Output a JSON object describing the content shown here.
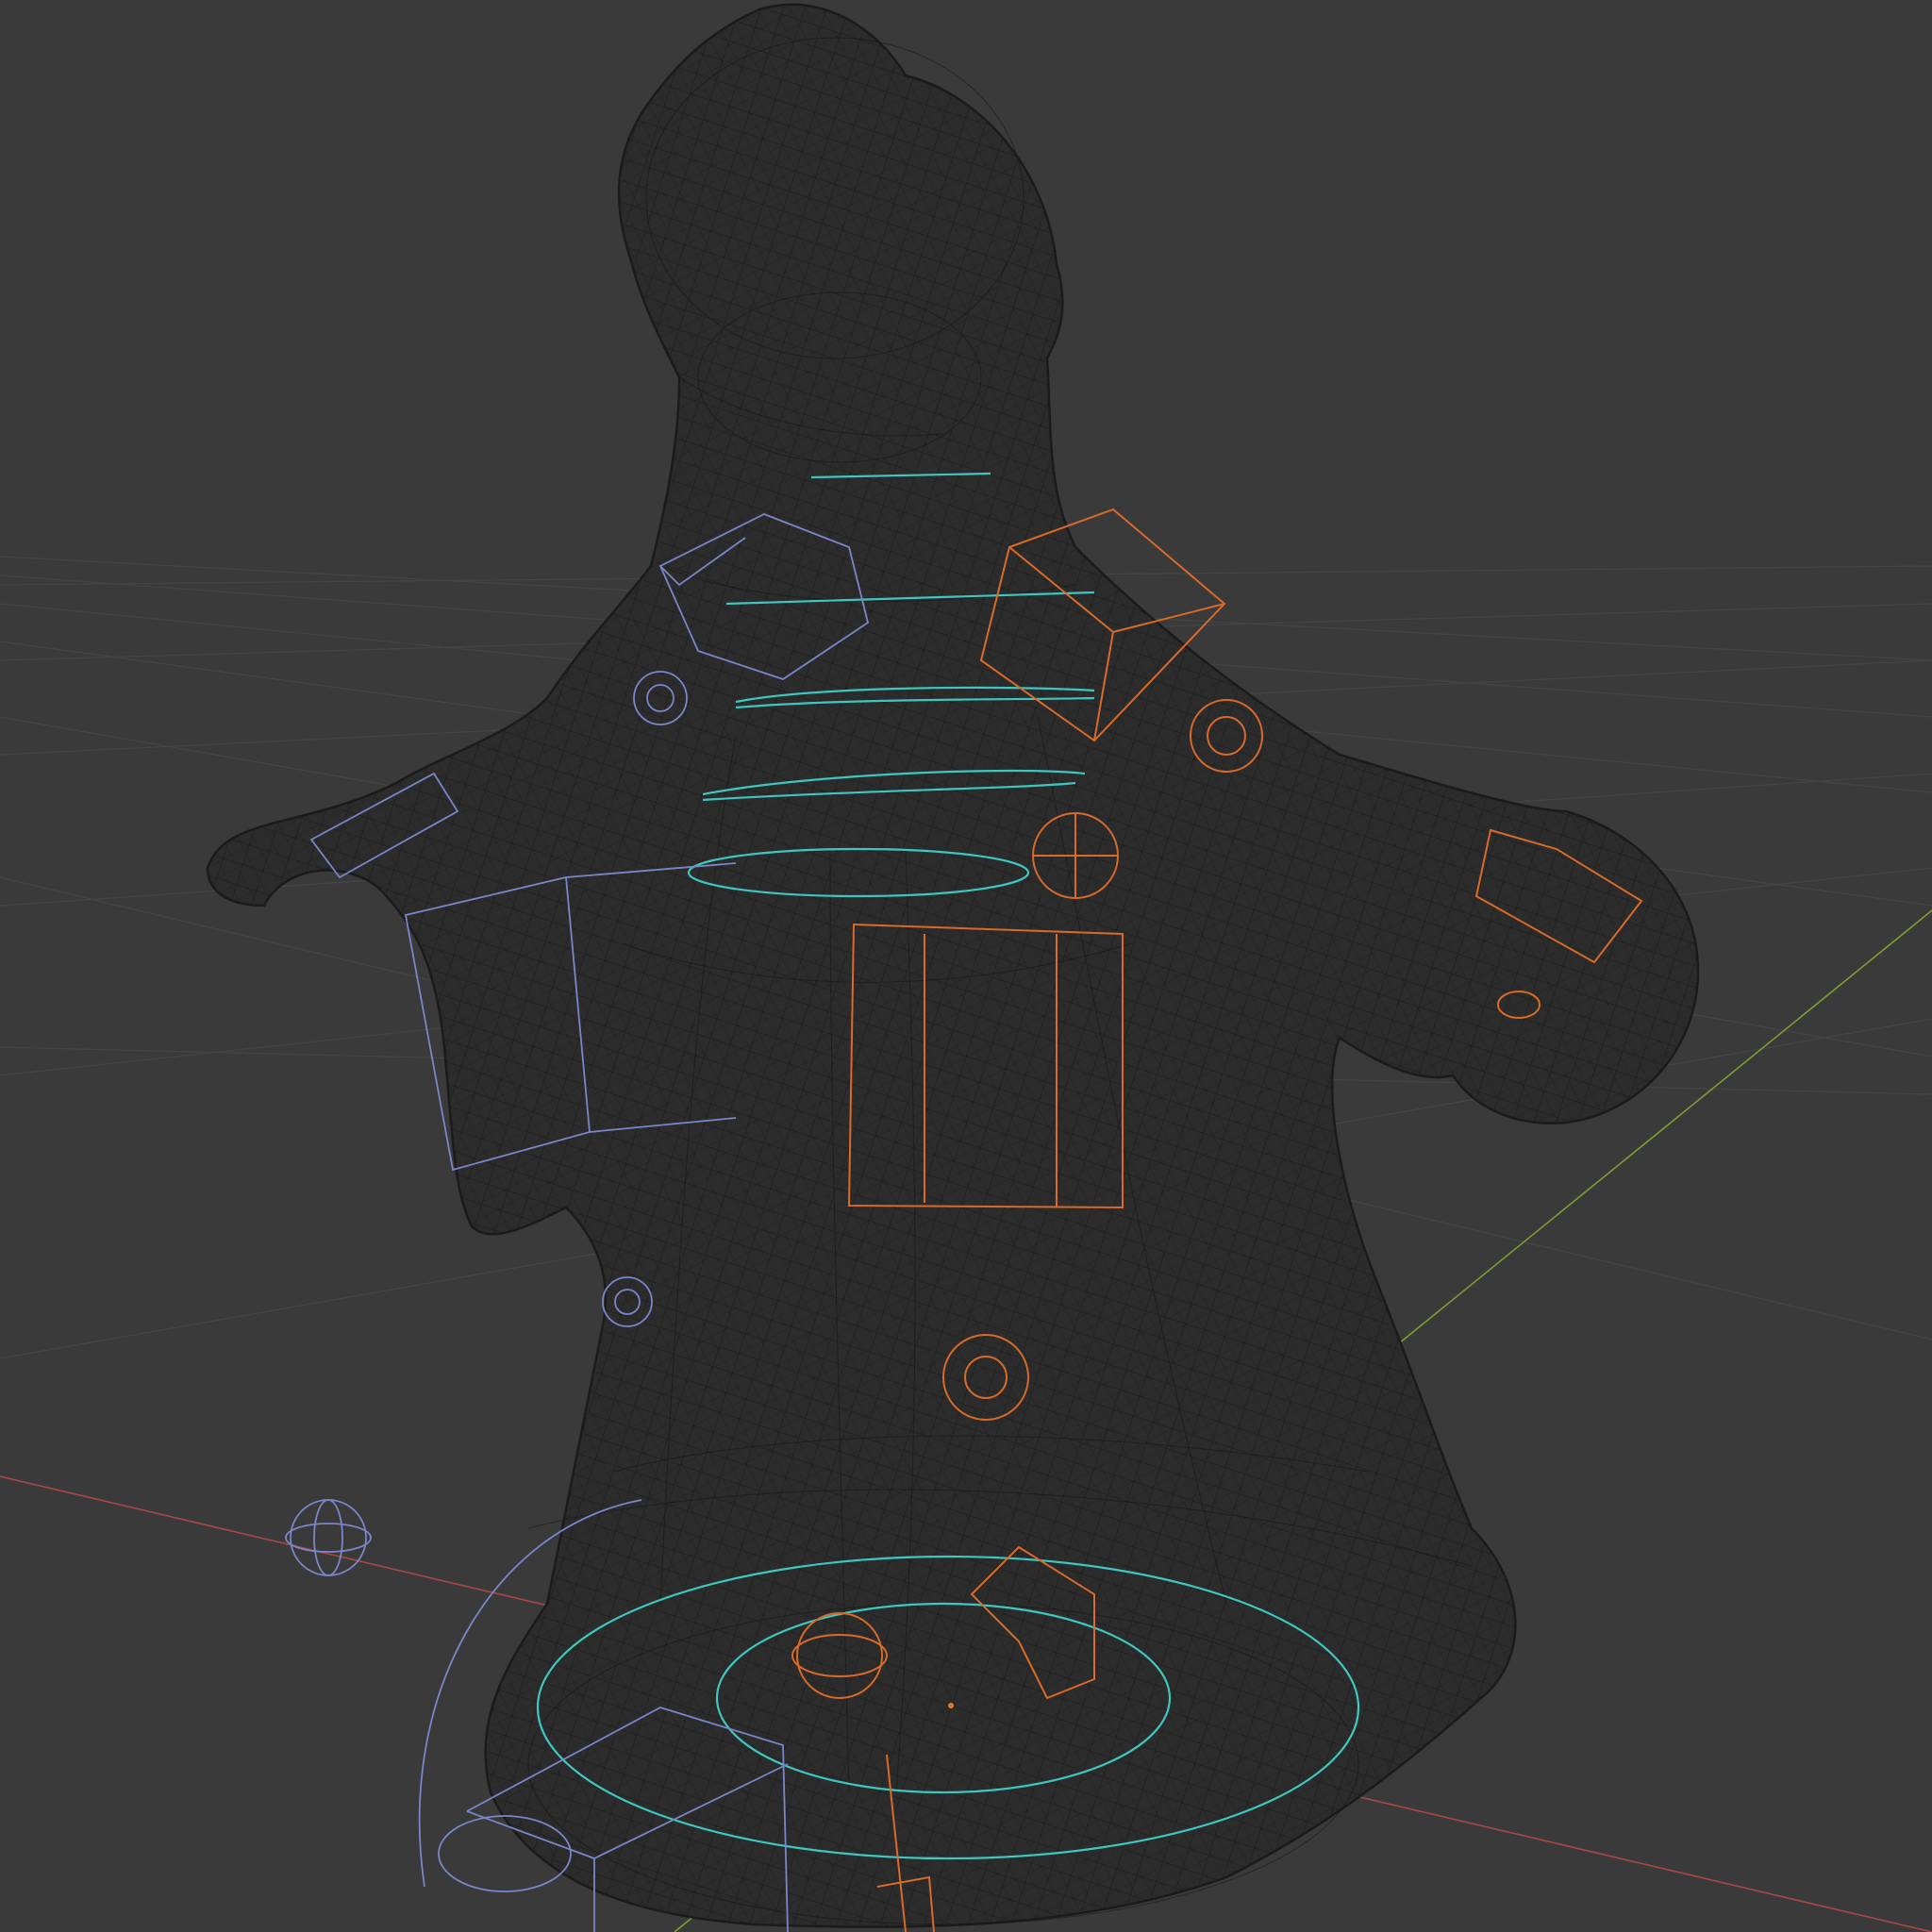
{
  "viewport": {
    "view": "3D Viewport",
    "shading": "wireframe",
    "background_color": "#3a3a3a",
    "grid_color": "#454545",
    "axis_colors": {
      "x": "#a84848",
      "y": "#7f9c35",
      "z": "#5b6ea8"
    }
  },
  "scene": {
    "mesh": {
      "type": "character",
      "wire_color": "#161616"
    },
    "rig_controls": {
      "left_side_color": "#7a86c8",
      "right_side_color": "#d86a2a",
      "spine_color": "#3ec7c0"
    },
    "origin_point_color": "#e07a30"
  }
}
